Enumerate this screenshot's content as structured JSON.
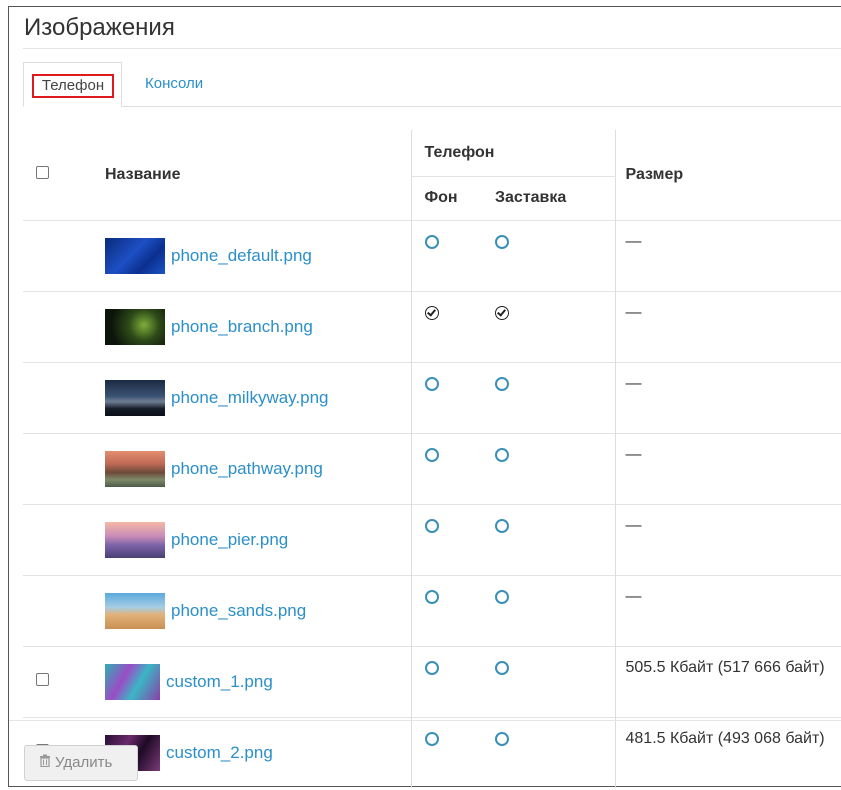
{
  "page": {
    "title": "Изображения"
  },
  "tabs": [
    {
      "label": "Телефон",
      "active": true
    },
    {
      "label": "Консоли",
      "active": false
    }
  ],
  "table": {
    "col_name": "Название",
    "group_phone": "Телефон",
    "col_background": "Фон",
    "col_screensaver": "Заставка",
    "col_size": "Размер",
    "rows": [
      {
        "name": "phone_default.png",
        "checkbox": false,
        "background": false,
        "screensaver": false,
        "size": "—",
        "thumb": "blue-abstract"
      },
      {
        "name": "phone_branch.png",
        "checkbox": false,
        "background": true,
        "screensaver": true,
        "size": "—",
        "thumb": "green-branch"
      },
      {
        "name": "phone_milkyway.png",
        "checkbox": false,
        "background": false,
        "screensaver": false,
        "size": "—",
        "thumb": "milkyway"
      },
      {
        "name": "phone_pathway.png",
        "checkbox": false,
        "background": false,
        "screensaver": false,
        "size": "—",
        "thumb": "pathway"
      },
      {
        "name": "phone_pier.png",
        "checkbox": false,
        "background": false,
        "screensaver": false,
        "size": "—",
        "thumb": "pier"
      },
      {
        "name": "phone_sands.png",
        "checkbox": false,
        "background": false,
        "screensaver": false,
        "size": "—",
        "thumb": "sands"
      },
      {
        "name": "custom_1.png",
        "checkbox": true,
        "background": false,
        "screensaver": false,
        "size": "505.5 Кбайт (517 666 байт)",
        "thumb": "custom1"
      },
      {
        "name": "custom_2.png",
        "checkbox": true,
        "background": false,
        "screensaver": false,
        "size": "481.5 Кбайт (493 068 байт)",
        "thumb": "custom2"
      }
    ]
  },
  "footer": {
    "delete_label": "Удалить"
  },
  "colors": {
    "link": "#2b8fc9",
    "highlight_border": "#e0191e",
    "radio": "#3a8fb7"
  }
}
